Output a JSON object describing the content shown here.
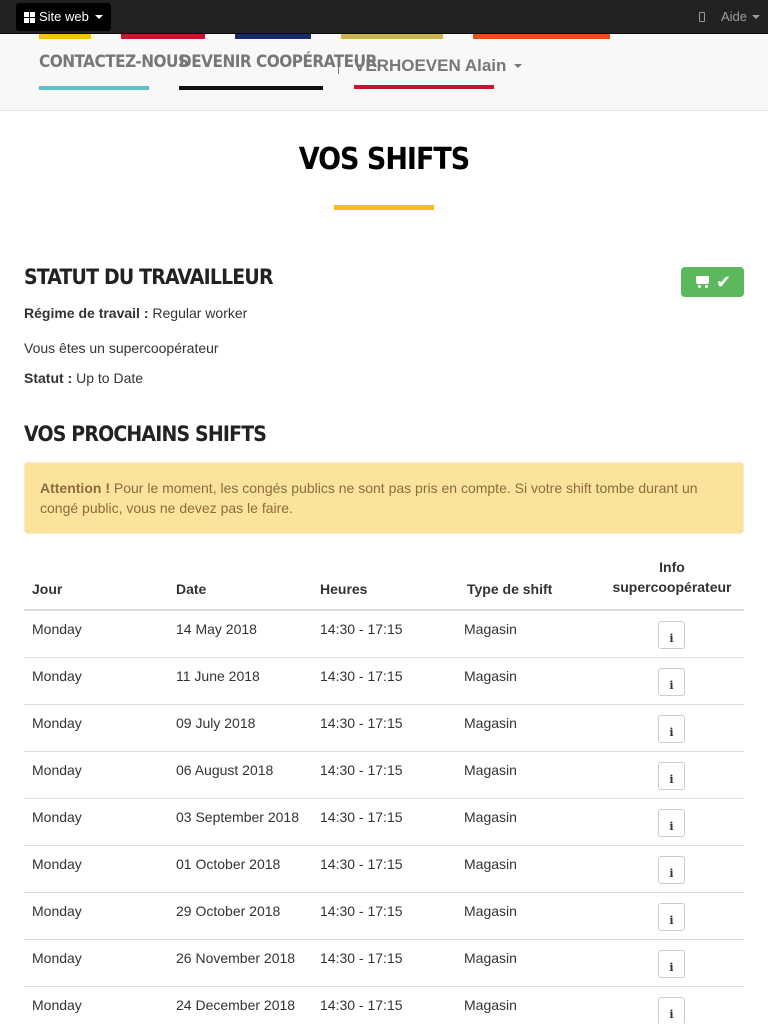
{
  "topbar": {
    "site_label": "Site web",
    "help_label": "Aide"
  },
  "nav": {
    "items": [
      {
        "label": "CONTACTEZ-NOUS",
        "color": "#5bc0c8"
      },
      {
        "label": "DEVENIR COOPÉRATEUR",
        "color": "#111111"
      }
    ],
    "user_label": "VERHOEVEN Alain",
    "user_color": "#c0182f",
    "stub_colors": [
      "#f5c20b",
      "#c0182f",
      "#1a2a6c",
      "#c9b64f",
      "#e8501a"
    ]
  },
  "page": {
    "title": "VOS SHIFTS",
    "accent": "#f5c20b"
  },
  "worker_status": {
    "heading": "STATUT DU TRAVAILLEUR",
    "regime_label": "Régime de travail :",
    "regime_value": "Regular worker",
    "supercoop_text": "Vous êtes un supercoopérateur",
    "status_label": "Statut :",
    "status_value": "Up to Date",
    "badge_color": "#5cb85c"
  },
  "next_shifts": {
    "heading": "VOS PROCHAINS SHIFTS",
    "alert_strong": "Attention !",
    "alert_text": " Pour le moment, les congés publics ne sont pas pris en compte. Si votre shift tombe durant un congé public, vous ne devez pas le faire."
  },
  "table": {
    "headers": {
      "day": "Jour",
      "date": "Date",
      "hours": "Heures",
      "type": "Type de shift",
      "info": "Info supercoopérateur"
    },
    "rows": [
      {
        "day": "Monday",
        "date": "14 May 2018",
        "hours": "14:30 - 17:15",
        "type": "Magasin"
      },
      {
        "day": "Monday",
        "date": "11 June 2018",
        "hours": "14:30 - 17:15",
        "type": "Magasin"
      },
      {
        "day": "Monday",
        "date": "09 July 2018",
        "hours": "14:30 - 17:15",
        "type": "Magasin"
      },
      {
        "day": "Monday",
        "date": "06 August 2018",
        "hours": "14:30 - 17:15",
        "type": "Magasin"
      },
      {
        "day": "Monday",
        "date": "03 September 2018",
        "hours": "14:30 - 17:15",
        "type": "Magasin"
      },
      {
        "day": "Monday",
        "date": "01 October 2018",
        "hours": "14:30 - 17:15",
        "type": "Magasin"
      },
      {
        "day": "Monday",
        "date": "29 October 2018",
        "hours": "14:30 - 17:15",
        "type": "Magasin"
      },
      {
        "day": "Monday",
        "date": "26 November 2018",
        "hours": "14:30 - 17:15",
        "type": "Magasin"
      },
      {
        "day": "Monday",
        "date": "24 December 2018",
        "hours": "14:30 - 17:15",
        "type": "Magasin"
      }
    ],
    "info_icon_glyph": "i"
  }
}
